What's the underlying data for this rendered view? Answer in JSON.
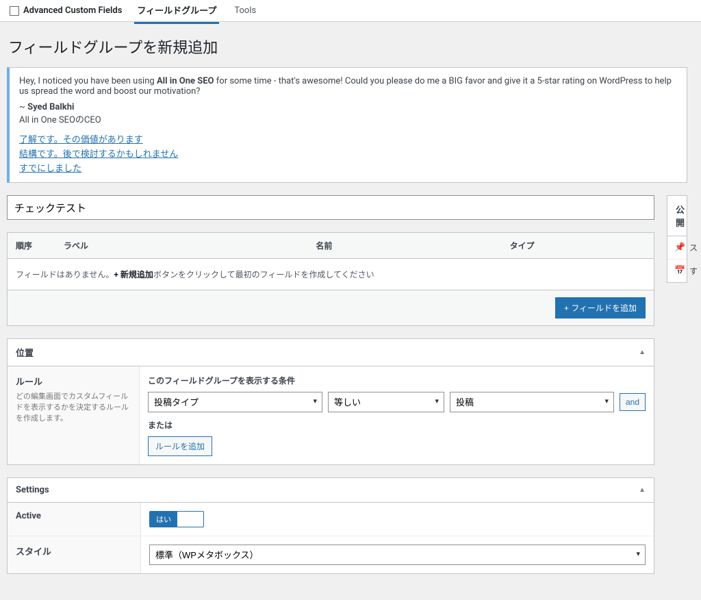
{
  "nav": {
    "brand": "Advanced Custom Fields",
    "items": [
      {
        "label": "フィールドグループ",
        "active": true
      },
      {
        "label": "Tools",
        "active": false
      }
    ]
  },
  "page_title": "フィールドグループを新規追加",
  "notice": {
    "msg_pre": "Hey, I noticed you have been using ",
    "msg_product": "All in One SEO",
    "msg_post": " for some time - that's awesome! Could you please do me a BIG favor and give it a 5-star rating on WordPress to help us spread the word and boost our motivation?",
    "author_prefix": "~ ",
    "author_name": "Syed Balkhi",
    "author_title": "All in One SEOのCEO",
    "links": {
      "yes": "了解です。その価値があります",
      "later": "結構です。後で検討するかもしれません",
      "done": "すでにしました"
    }
  },
  "title_input": "チェックテスト",
  "fields_table": {
    "cols": {
      "order": "順序",
      "label": "ラベル",
      "name": "名前",
      "type": "タイプ"
    },
    "empty_pre": "フィールドはありません。",
    "empty_strong": "+ 新規追加",
    "empty_post": "ボタンをクリックして最初のフィールドを作成してください",
    "add_btn": "+ フィールドを追加"
  },
  "location": {
    "title": "位置",
    "label": "ルール",
    "hint": "どの編集画面でカスタムフィールドを表示するかを決定するルールを作成します。",
    "desc": "このフィールドグループを表示する条件",
    "select1": "投稿タイプ",
    "select2": "等しい",
    "select3": "投稿",
    "and": "and",
    "or": "または",
    "add_rule": "ルールを追加"
  },
  "settings": {
    "title": "Settings",
    "active_label": "Active",
    "active_on": "はい",
    "style_label": "スタイル",
    "style_value": "標準（WPメタボックス）"
  },
  "sidebar": {
    "publish_title": "公開",
    "status_label": "ス",
    "visibility_label": "す"
  }
}
